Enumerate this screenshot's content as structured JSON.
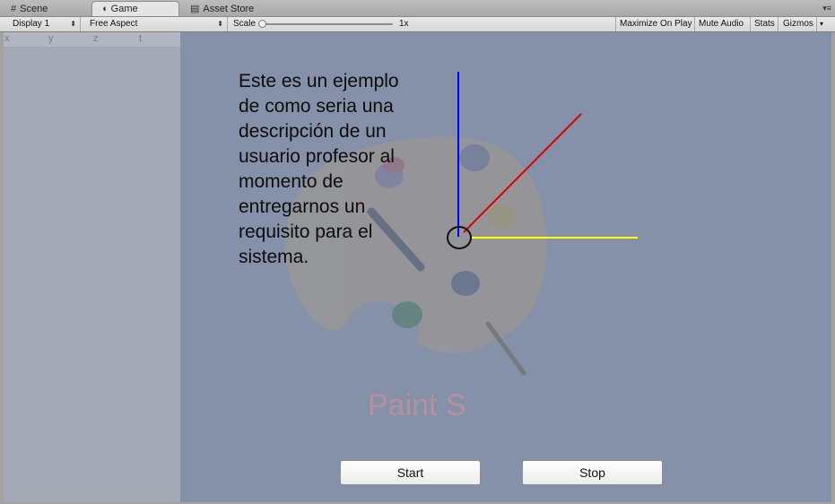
{
  "tabs": [
    {
      "label": "Scene",
      "icon": "grid-icon"
    },
    {
      "label": "Game",
      "icon": "pacman-icon"
    },
    {
      "label": "Asset Store",
      "icon": "store-icon"
    }
  ],
  "toolbar": {
    "display": "Display 1",
    "aspect": "Free Aspect",
    "scale_label": "Scale",
    "scale_value": "1x",
    "maximize": "Maximize On Play",
    "mute": "Mute Audio",
    "stats": "Stats",
    "gizmos": "Gizmos"
  },
  "panel": {
    "axes": [
      "x",
      "y",
      "z",
      "t"
    ]
  },
  "game": {
    "description": "Este es un ejemplo de como seria una descripción de un usuario profesor al momento de entregarnos un requisito para el sistema.",
    "description_lines": [
      "Este es un ejemplo",
      "de como seria una",
      "descripción de un",
      "usuario profesor al",
      "momento de",
      "entregarnos un",
      "requisito para el",
      "sistema."
    ],
    "watermark": "Paint S",
    "start_label": "Start",
    "stop_label": "Stop",
    "gizmo_colors": {
      "up": "#0000ff",
      "diagonal": "#dd0000",
      "right": "#ffff00"
    }
  }
}
